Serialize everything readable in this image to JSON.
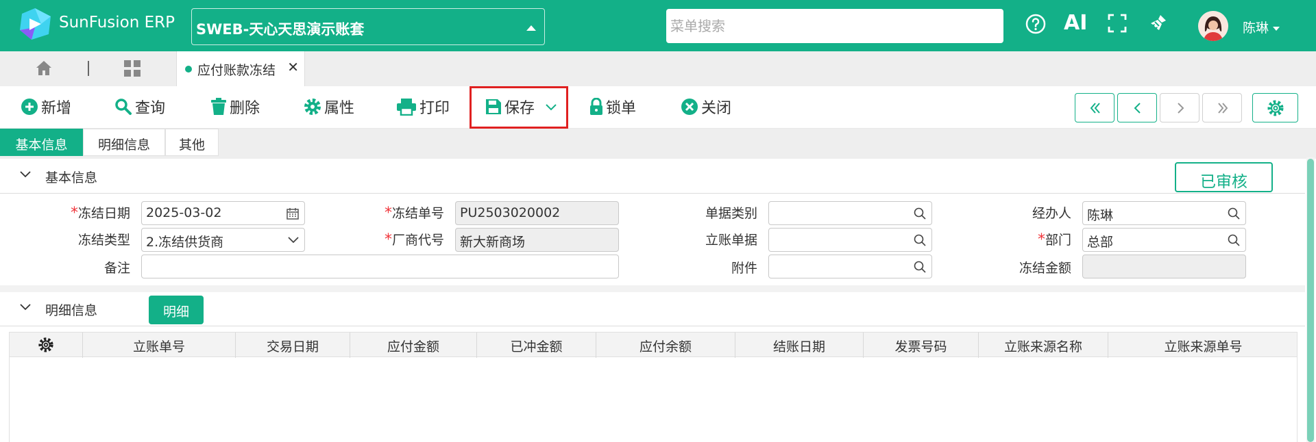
{
  "app": {
    "brand": "SunFusion ERP",
    "company": "SWEB-天心天思演示账套",
    "search_placeholder": "菜单搜索",
    "ai_label": "AI",
    "user_name": "陈琳",
    "accent": "#13b088"
  },
  "tabs": {
    "active_label": "应付账款冻结",
    "close_symbol": "✕"
  },
  "toolbar": {
    "add": "新增",
    "query": "查询",
    "delete": "删除",
    "properties": "属性",
    "print": "打印",
    "save": "保存",
    "lock": "锁单",
    "close": "关闭"
  },
  "subtabs": [
    "基本信息",
    "明细信息",
    "其他"
  ],
  "basic": {
    "section_title": "基本信息",
    "status": "已审核",
    "labels": {
      "freeze_date": "冻结日期",
      "freeze_no": "冻结单号",
      "doc_type": "单据类别",
      "handler": "经办人",
      "freeze_type": "冻结类型",
      "vendor_code": "厂商代号",
      "account_doc": "立账单据",
      "department": "部门",
      "remark": "备注",
      "attachment": "附件",
      "freeze_amount": "冻结金额"
    },
    "values": {
      "freeze_date": "2025-03-02",
      "freeze_no": "PU2503020002",
      "doc_type": "",
      "handler": "陈琳",
      "freeze_type": "2.冻结供货商",
      "vendor_code": "新大新商场",
      "account_doc": "",
      "department": "总部",
      "remark": "",
      "attachment": "",
      "freeze_amount": ""
    }
  },
  "detail": {
    "section_title": "明细信息",
    "detail_button": "明细",
    "columns": [
      "立账单号",
      "交易日期",
      "应付金额",
      "已冲金额",
      "应付余额",
      "结账日期",
      "发票号码",
      "立账来源名称",
      "立账来源单号"
    ],
    "rows": []
  }
}
